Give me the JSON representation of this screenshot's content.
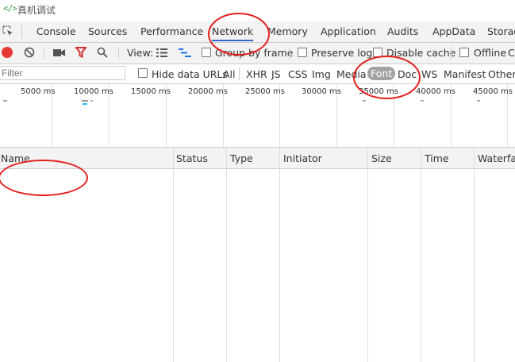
{
  "window": {
    "title": "真机调试",
    "code_icon": "</>"
  },
  "tabs": [
    "Console",
    "Sources",
    "Performance",
    "Network",
    "Memory",
    "Application",
    "Audits",
    "AppData",
    "Storag"
  ],
  "toolbar": {
    "view_label": "View:",
    "group_by_frame": "Group by frame",
    "preserve_log": "Preserve log",
    "disable_cache": "Disable cache",
    "offline": "Offline",
    "overflow": "C"
  },
  "filter": {
    "placeholder": "Filter",
    "hide_data_urls": "Hide data URLs",
    "types": [
      "All",
      "XHR",
      "JS",
      "CSS",
      "Img",
      "Media",
      "Font",
      "Doc",
      "WS",
      "Manifest",
      "Other"
    ],
    "active_type": "Font"
  },
  "overview": {
    "ticks": [
      "5000 ms",
      "10000 ms",
      "15000 ms",
      "20000 ms",
      "25000 ms",
      "30000 ms",
      "35000 ms",
      "40000 ms",
      "45000 ms"
    ]
  },
  "table": {
    "columns": [
      "Name",
      "Status",
      "Type",
      "Initiator",
      "Size",
      "Time",
      "Waterfall"
    ]
  },
  "colors": {
    "record": "#e53935",
    "filter_active": "#d32f2f",
    "accent": "#3367d6",
    "annotation": "#e3201b",
    "font_pill": "#a3a3a3"
  }
}
